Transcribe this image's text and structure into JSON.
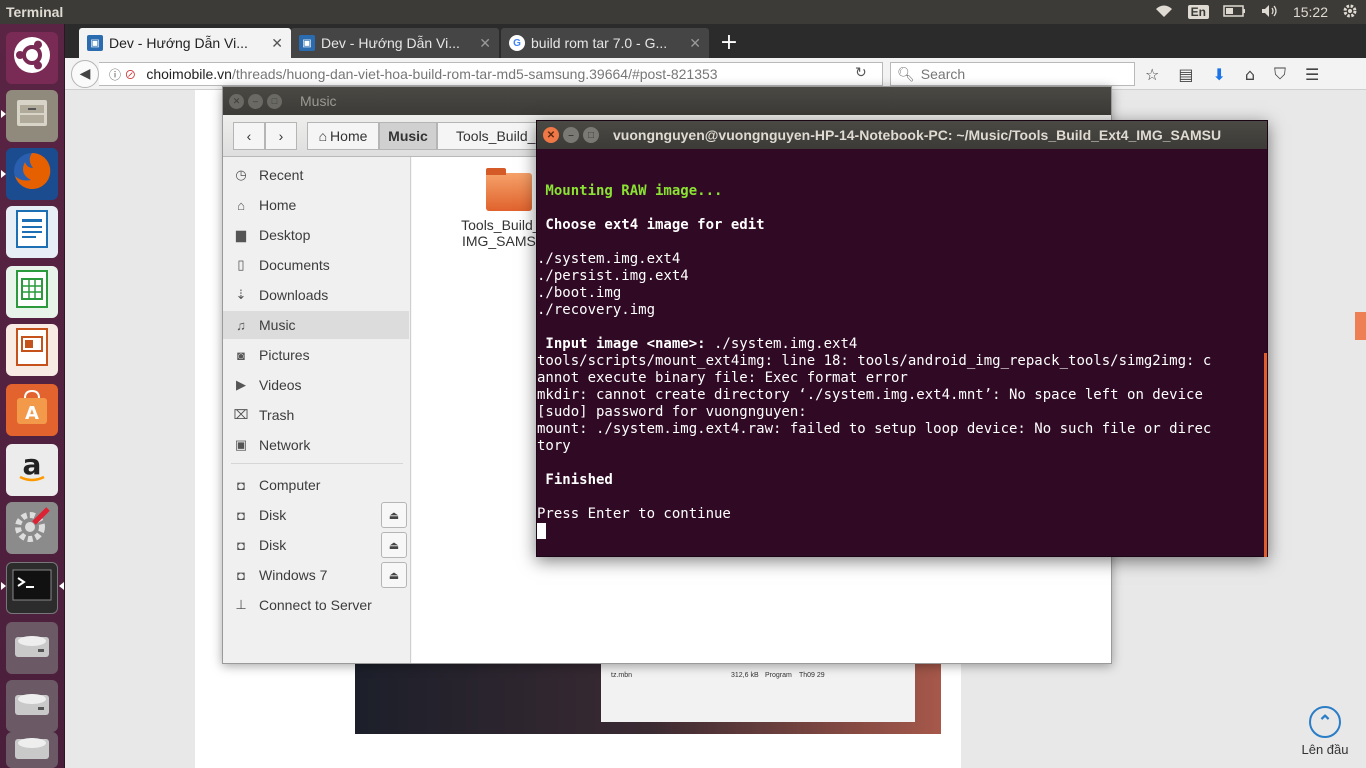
{
  "top_panel": {
    "app_title": "Terminal",
    "keyboard_layout": "En",
    "clock": "15:22"
  },
  "launcher": {
    "items": [
      {
        "name": "dash-home",
        "icon": "ubuntu-logo-icon",
        "color": "#d64a23"
      },
      {
        "name": "files",
        "icon": "files-icon",
        "color": "#8f8a7c"
      },
      {
        "name": "firefox",
        "icon": "firefox-icon",
        "color": "#e66000"
      },
      {
        "name": "libreoffice-writer",
        "icon": "writer-icon",
        "color": "#1d6fb4"
      },
      {
        "name": "libreoffice-calc",
        "icon": "calc-icon",
        "color": "#2b9a3d"
      },
      {
        "name": "libreoffice-impress",
        "icon": "impress-icon",
        "color": "#c6521b"
      },
      {
        "name": "software-center",
        "icon": "software-center-icon",
        "color": "#e2632d"
      },
      {
        "name": "amazon",
        "icon": "amazon-icon",
        "color": "#ececec"
      },
      {
        "name": "system-settings",
        "icon": "settings-icon",
        "color": "#8b8b8b"
      },
      {
        "name": "terminal",
        "icon": "terminal-icon",
        "color": "#2c2c2c"
      },
      {
        "name": "disk-1",
        "icon": "disk-icon",
        "color": "#c9c9c9"
      },
      {
        "name": "disk-2",
        "icon": "disk-icon",
        "color": "#c9c9c9"
      },
      {
        "name": "disk-3",
        "icon": "disk-icon",
        "color": "#c9c9c9"
      }
    ]
  },
  "browser": {
    "tabs": [
      {
        "label": "Dev - Hướng Dẫn Vi...",
        "active": true
      },
      {
        "label": "Dev - Hướng Dẫn Vi...",
        "active": false
      },
      {
        "label": "build rom tar 7.0 - G...",
        "active": false
      }
    ],
    "url_host": "choimobile.vn",
    "url_path": "/threads/huong-dan-viet-hoa-build-rom-tar-md5-samsung.39664/#post-821353",
    "search_placeholder": "Search",
    "back_to_top_label": "Lên đầu",
    "page_image": {
      "file_name": "tz.mbn",
      "file_size": "312,6 kB",
      "file_type": "Program",
      "file_time": "Th09 29"
    }
  },
  "files_window": {
    "title": "Music",
    "toolbar": {
      "home_label": "Home",
      "music_label": "Music",
      "path_label": "Tools_Build_"
    },
    "sidebar": [
      {
        "label": "Recent",
        "icon": "clock-icon"
      },
      {
        "label": "Home",
        "icon": "home-icon"
      },
      {
        "label": "Desktop",
        "icon": "folder-icon"
      },
      {
        "label": "Documents",
        "icon": "document-icon"
      },
      {
        "label": "Downloads",
        "icon": "download-icon"
      },
      {
        "label": "Music",
        "icon": "music-icon",
        "selected": true
      },
      {
        "label": "Pictures",
        "icon": "camera-icon"
      },
      {
        "label": "Videos",
        "icon": "video-icon"
      },
      {
        "label": "Trash",
        "icon": "trash-icon"
      },
      {
        "label": "Network",
        "icon": "network-icon"
      },
      {
        "label": "Computer",
        "icon": "drive-icon"
      },
      {
        "label": "Disk",
        "icon": "drive-icon",
        "eject": true
      },
      {
        "label": "Disk",
        "icon": "drive-icon",
        "eject": true
      },
      {
        "label": "Windows 7",
        "icon": "drive-icon",
        "eject": true
      },
      {
        "label": "Connect to Server",
        "icon": "server-icon"
      }
    ],
    "folder": {
      "line1": "Tools_Build_Ex",
      "line2": "IMG_SAMSUN"
    }
  },
  "terminal": {
    "title": "vuongnguyen@vuongnguyen-HP-14-Notebook-PC: ~/Music/Tools_Build_Ext4_IMG_SAMSU",
    "lines": {
      "mounting": " Mounting RAW image...",
      "choose": " Choose ext4 image for edit",
      "f1": "./system.img.ext4",
      "f2": "./persist.img.ext4",
      "f3": "./boot.img",
      "f4": "./recovery.img",
      "input_prompt": " Input image <name>:",
      "input_value": " ./system.img.ext4",
      "err1": "tools/scripts/mount_ext4img: line 18: tools/android_img_repack_tools/simg2img: c",
      "err2": "annot execute binary file: Exec format error",
      "err3": "mkdir: cannot create directory ‘./system.img.ext4.mnt’: No space left on device",
      "err4": "[sudo] password for vuongnguyen:",
      "err5": "mount: ./system.img.ext4.raw: failed to setup loop device: No such file or direc",
      "err6": "tory",
      "finished": " Finished",
      "press": "Press Enter to continue"
    }
  }
}
